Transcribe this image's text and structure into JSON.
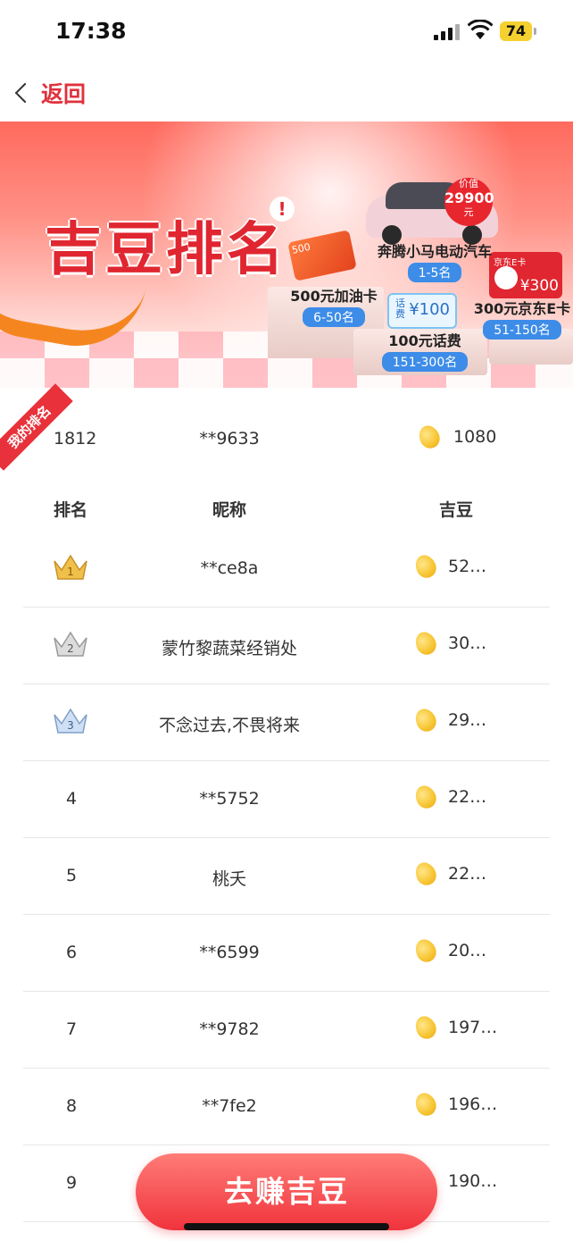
{
  "status_bar": {
    "time": "17:38",
    "battery": "74"
  },
  "nav": {
    "back_label": "返回"
  },
  "banner": {
    "title": "吉豆排名",
    "bang": "!",
    "car_price_label": "价值",
    "car_price_value": "29900",
    "car_price_unit": "元",
    "oil_card_text": "500",
    "phone_card_small": "话费",
    "phone_card_amount": "¥100",
    "jd_card_brand": "京东E卡",
    "jd_card_amount": "¥300",
    "prizes": [
      {
        "name": "奔腾小马电动汽车",
        "rank": "1-5名"
      },
      {
        "name": "500元加油卡",
        "rank": "6-50名"
      },
      {
        "name": "100元话费",
        "rank": "151-300名"
      },
      {
        "name": "300元京东E卡",
        "rank": "51-150名"
      }
    ]
  },
  "my_rank": {
    "tag": "我的排名",
    "rank": "1812",
    "nickname": "**9633",
    "beans": "1080"
  },
  "table": {
    "headers": {
      "rank": "排名",
      "nickname": "昵称",
      "beans": "吉豆"
    },
    "rows": [
      {
        "rank": "1",
        "nickname": "**ce8a",
        "beans": "52…",
        "crown": "gold"
      },
      {
        "rank": "2",
        "nickname": "蒙竹黎蔬菜经销处",
        "beans": "30…",
        "crown": "silver"
      },
      {
        "rank": "3",
        "nickname": "不念过去,不畏将来",
        "beans": "29…",
        "crown": "bronze"
      },
      {
        "rank": "4",
        "nickname": "**5752",
        "beans": "22…"
      },
      {
        "rank": "5",
        "nickname": "桃夭",
        "beans": "22…"
      },
      {
        "rank": "6",
        "nickname": "**6599",
        "beans": "20…"
      },
      {
        "rank": "7",
        "nickname": "**9782",
        "beans": "197…"
      },
      {
        "rank": "8",
        "nickname": "**7fe2",
        "beans": "196…"
      },
      {
        "rank": "9",
        "nickname": "",
        "beans": "190…"
      }
    ]
  },
  "cta": {
    "label": "去赚吉豆"
  },
  "colors": {
    "accent": "#e02630",
    "badge_blue": "#3d8ce8",
    "bean_yellow": "#f7c430"
  }
}
